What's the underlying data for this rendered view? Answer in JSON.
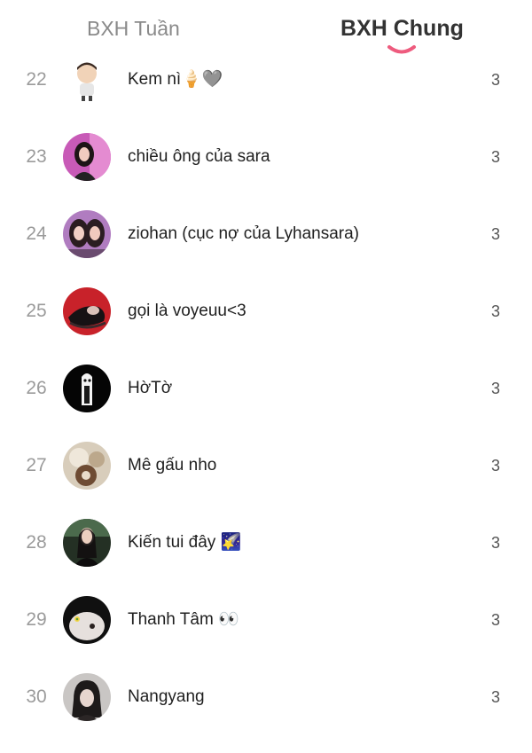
{
  "tabs": {
    "week_label": "BXH Tuần",
    "all_label": "BXH Chung",
    "indicator_color": "#ee5b7e"
  },
  "leaderboard": [
    {
      "rank": "22",
      "name": "Kem nì🍦🩶",
      "score": "3"
    },
    {
      "rank": "23",
      "name": "chiều ông của sara",
      "score": "3"
    },
    {
      "rank": "24",
      "name": "ziohan (cục nợ của Lyhansara)",
      "score": "3"
    },
    {
      "rank": "25",
      "name": "gọi là voyeuu<3",
      "score": "3"
    },
    {
      "rank": "26",
      "name": "HờTờ",
      "score": "3"
    },
    {
      "rank": "27",
      "name": "Mê gấu nho",
      "score": "3"
    },
    {
      "rank": "28",
      "name": "Kiến tui đây 🌠",
      "score": "3"
    },
    {
      "rank": "29",
      "name": "Thanh Tâm 👀",
      "score": "3"
    },
    {
      "rank": "30",
      "name": "Nangyang",
      "score": "3"
    }
  ]
}
